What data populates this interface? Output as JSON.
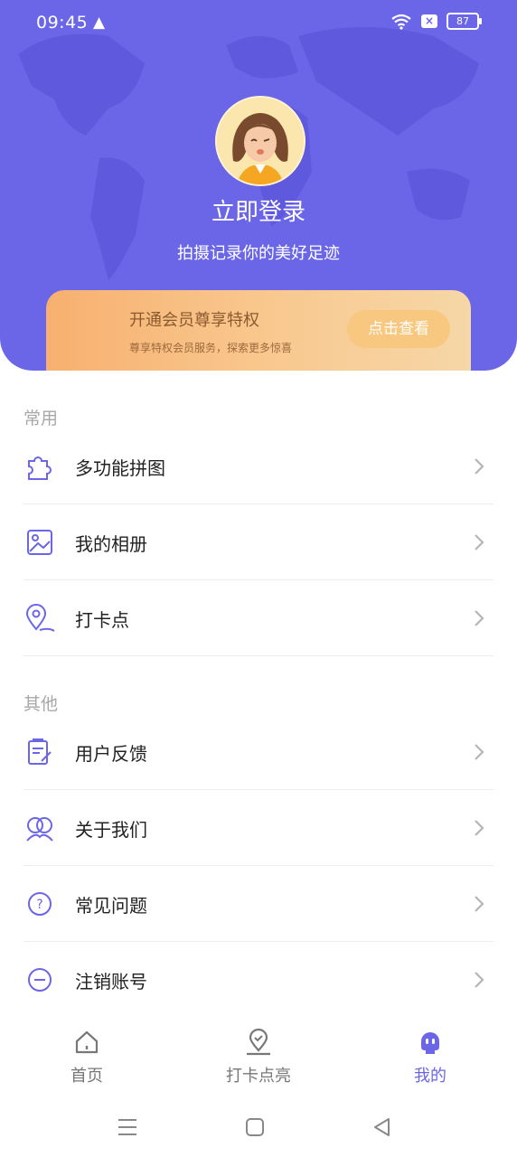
{
  "status": {
    "time": "09:45",
    "battery": "87"
  },
  "profile": {
    "login_title": "立即登录",
    "login_subtitle": "拍摄记录你的美好足迹"
  },
  "vip": {
    "title": "开通会员尊享特权",
    "subtitle": "尊享特权会员服务，探索更多惊喜",
    "button": "点击查看"
  },
  "sections": {
    "common": {
      "title": "常用",
      "items": [
        {
          "label": "多功能拼图",
          "icon": "puzzle-icon"
        },
        {
          "label": "我的相册",
          "icon": "image-icon"
        },
        {
          "label": "打卡点",
          "icon": "location-pin-icon"
        }
      ]
    },
    "other": {
      "title": "其他",
      "items": [
        {
          "label": "用户反馈",
          "icon": "feedback-clipboard-icon"
        },
        {
          "label": "关于我们",
          "icon": "people-icon"
        },
        {
          "label": "常见问题",
          "icon": "question-circle-icon"
        },
        {
          "label": "注销账号",
          "icon": "minus-circle-icon"
        }
      ]
    }
  },
  "tabs": [
    {
      "label": "首页",
      "icon": "home-icon",
      "active": false
    },
    {
      "label": "打卡点亮",
      "icon": "map-pin-icon",
      "active": false
    },
    {
      "label": "我的",
      "icon": "profile-ghost-icon",
      "active": true
    }
  ],
  "colors": {
    "primary": "#6b66e8",
    "vip_gold": "#f7b06f"
  }
}
